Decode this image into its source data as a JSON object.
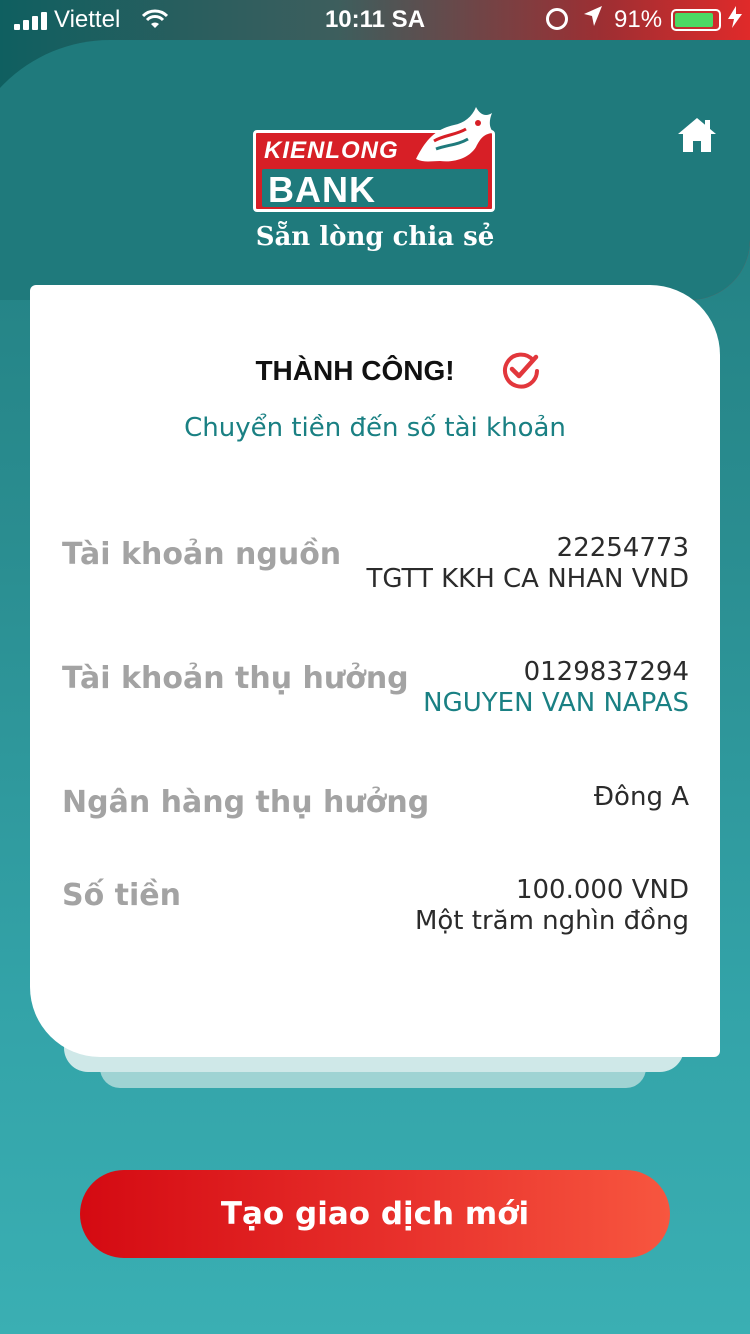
{
  "status_bar": {
    "carrier": "Viettel",
    "time": "10:11 SA",
    "battery_percent": "91%",
    "battery_level": 0.91,
    "icons": [
      "signal-icon",
      "wifi-icon",
      "rotation-lock-icon",
      "location-icon",
      "battery-icon",
      "charging-icon"
    ]
  },
  "brand": {
    "logo_top": "KIENLONG",
    "logo_bottom": "BANK",
    "slogan": "Sẵn lòng chia sẻ",
    "colors": {
      "red": "#d71f26",
      "teal": "#1f7a7c"
    }
  },
  "header": {
    "home_icon": "home-icon"
  },
  "result": {
    "title": "THÀNH CÔNG!",
    "status_icon": "check-circle-icon",
    "subtitle": "Chuyển tiền đến số tài khoản"
  },
  "details": {
    "source": {
      "label": "Tài khoản nguồn",
      "account": "22254773",
      "name": "TGTT KKH CA NHAN VND"
    },
    "beneficiary": {
      "label": "Tài khoản thụ hưởng",
      "account": "0129837294",
      "name": "NGUYEN VAN NAPAS"
    },
    "bank": {
      "label": "Ngân hàng thụ hưởng",
      "value": "Đông A"
    },
    "amount": {
      "label": "Số tiền",
      "value": "100.000 VND",
      "in_words": "Một trăm nghìn đồng"
    }
  },
  "actions": {
    "new_transaction": "Tạo giao dịch mới"
  }
}
